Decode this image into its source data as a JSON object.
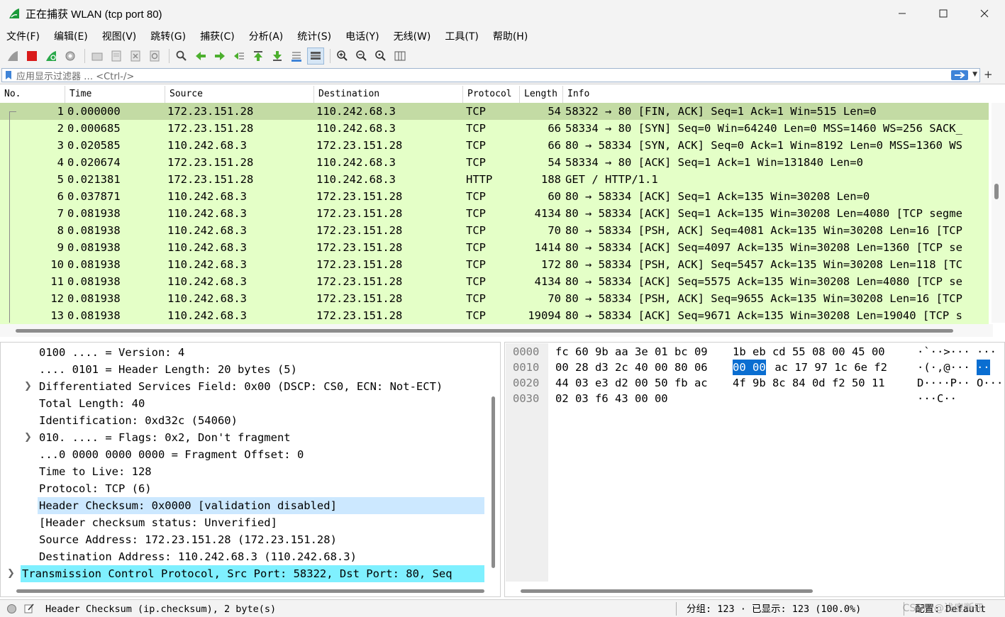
{
  "window": {
    "title": "正在捕获 WLAN (tcp port 80)",
    "icons": [
      "wireshark-fin-icon",
      "minimize-icon",
      "maximize-icon",
      "close-icon"
    ]
  },
  "menu": [
    "文件(F)",
    "编辑(E)",
    "视图(V)",
    "跳转(G)",
    "捕获(C)",
    "分析(A)",
    "统计(S)",
    "电话(Y)",
    "无线(W)",
    "工具(T)",
    "帮助(H)"
  ],
  "toolbar": {
    "icons": [
      "start-capture-icon",
      "stop-capture-icon",
      "restart-capture-icon",
      "capture-options-icon",
      "open-file-icon",
      "save-file-icon",
      "close-file-icon",
      "reload-file-icon",
      "find-packet-icon",
      "go-back-icon",
      "go-forward-icon",
      "go-to-packet-icon",
      "first-packet-icon",
      "last-packet-icon",
      "autoscroll-icon",
      "colorize-icon",
      "zoom-in-icon",
      "zoom-out-icon",
      "normal-size-icon",
      "resize-columns-icon"
    ]
  },
  "filter": {
    "placeholder": "应用显示过滤器 … <Ctrl-/>",
    "plus": "+"
  },
  "packet_list": {
    "columns": [
      "No.",
      "Time",
      "Source",
      "Destination",
      "Protocol",
      "Length",
      "Info"
    ],
    "rows": [
      {
        "no": "1",
        "time": "0.000000",
        "source": "172.23.151.28",
        "destination": "110.242.68.3",
        "protocol": "TCP",
        "length": "54",
        "info": "58322 → 80 [FIN, ACK] Seq=1 Ack=1 Win=515 Len=0"
      },
      {
        "no": "2",
        "time": "0.000685",
        "source": "172.23.151.28",
        "destination": "110.242.68.3",
        "protocol": "TCP",
        "length": "66",
        "info": "58334 → 80 [SYN] Seq=0 Win=64240 Len=0 MSS=1460 WS=256 SACK_"
      },
      {
        "no": "3",
        "time": "0.020585",
        "source": "110.242.68.3",
        "destination": "172.23.151.28",
        "protocol": "TCP",
        "length": "66",
        "info": "80 → 58334 [SYN, ACK] Seq=0 Ack=1 Win=8192 Len=0 MSS=1360 WS"
      },
      {
        "no": "4",
        "time": "0.020674",
        "source": "172.23.151.28",
        "destination": "110.242.68.3",
        "protocol": "TCP",
        "length": "54",
        "info": "58334 → 80 [ACK] Seq=1 Ack=1 Win=131840 Len=0"
      },
      {
        "no": "5",
        "time": "0.021381",
        "source": "172.23.151.28",
        "destination": "110.242.68.3",
        "protocol": "HTTP",
        "length": "188",
        "info": "GET / HTTP/1.1"
      },
      {
        "no": "6",
        "time": "0.037871",
        "source": "110.242.68.3",
        "destination": "172.23.151.28",
        "protocol": "TCP",
        "length": "60",
        "info": "80 → 58334 [ACK] Seq=1 Ack=135 Win=30208 Len=0"
      },
      {
        "no": "7",
        "time": "0.081938",
        "source": "110.242.68.3",
        "destination": "172.23.151.28",
        "protocol": "TCP",
        "length": "4134",
        "info": "80 → 58334 [ACK] Seq=1 Ack=135 Win=30208 Len=4080 [TCP segme"
      },
      {
        "no": "8",
        "time": "0.081938",
        "source": "110.242.68.3",
        "destination": "172.23.151.28",
        "protocol": "TCP",
        "length": "70",
        "info": "80 → 58334 [PSH, ACK] Seq=4081 Ack=135 Win=30208 Len=16 [TCP"
      },
      {
        "no": "9",
        "time": "0.081938",
        "source": "110.242.68.3",
        "destination": "172.23.151.28",
        "protocol": "TCP",
        "length": "1414",
        "info": "80 → 58334 [ACK] Seq=4097 Ack=135 Win=30208 Len=1360 [TCP se"
      },
      {
        "no": "10",
        "time": "0.081938",
        "source": "110.242.68.3",
        "destination": "172.23.151.28",
        "protocol": "TCP",
        "length": "172",
        "info": "80 → 58334 [PSH, ACK] Seq=5457 Ack=135 Win=30208 Len=118 [TC"
      },
      {
        "no": "11",
        "time": "0.081938",
        "source": "110.242.68.3",
        "destination": "172.23.151.28",
        "protocol": "TCP",
        "length": "4134",
        "info": "80 → 58334 [ACK] Seq=5575 Ack=135 Win=30208 Len=4080 [TCP se"
      },
      {
        "no": "12",
        "time": "0.081938",
        "source": "110.242.68.3",
        "destination": "172.23.151.28",
        "protocol": "TCP",
        "length": "70",
        "info": "80 → 58334 [PSH, ACK] Seq=9655 Ack=135 Win=30208 Len=16 [TCP"
      },
      {
        "no": "13",
        "time": "0.081938",
        "source": "110.242.68.3",
        "destination": "172.23.151.28",
        "protocol": "TCP",
        "length": "19094",
        "info": "80 → 58334 [ACK] Seq=9671 Ack=135 Win=30208 Len=19040 [TCP s"
      }
    ],
    "row_color": "#e4ffc7",
    "selected_color": "#c3dba4"
  },
  "details": {
    "lines": [
      {
        "text": "0100 .... = Version: 4",
        "expander": false
      },
      {
        "text": ".... 0101 = Header Length: 20 bytes (5)",
        "expander": false
      },
      {
        "text": "Differentiated Services Field: 0x00 (DSCP: CS0, ECN: Not-ECT)",
        "expander": true
      },
      {
        "text": "Total Length: 40",
        "expander": false
      },
      {
        "text": "Identification: 0xd32c (54060)",
        "expander": false
      },
      {
        "text": "010. .... = Flags: 0x2, Don't fragment",
        "expander": true
      },
      {
        "text": "...0 0000 0000 0000 = Fragment Offset: 0",
        "expander": false
      },
      {
        "text": "Time to Live: 128",
        "expander": false
      },
      {
        "text": "Protocol: TCP (6)",
        "expander": false
      },
      {
        "text": "Header Checksum: 0x0000 [validation disabled]",
        "expander": false,
        "highlight": true
      },
      {
        "text": "[Header checksum status: Unverified]",
        "expander": false
      },
      {
        "text": "Source Address: 172.23.151.28 (172.23.151.28)",
        "expander": false
      },
      {
        "text": "Destination Address: 110.242.68.3 (110.242.68.3)",
        "expander": false
      }
    ],
    "protocol_line": "Transmission Control Protocol, Src Port: 58322, Dst Port: 80, Seq",
    "highlight_color": "#cce8ff",
    "protocol_color": "#7ff0ff"
  },
  "bytes": {
    "rows": [
      {
        "offset": "0000",
        "hex1": "fc 60 9b aa 3e 01 bc 09",
        "hex2a": "1b eb",
        "hex2sel": "",
        "hex2b": " cd 55 08 00 45 00",
        "ascii1": "·`··>···",
        "ascii2a": " ···",
        "asciisel": ""
      },
      {
        "offset": "0010",
        "hex1": "00 28 d3 2c 40 00 80 06",
        "hex2a": "",
        "hex2sel": "00 00",
        "hex2b": " ac 17 97 1c 6e f2",
        "ascii1": "·(·,@···",
        "ascii2a": " ",
        "asciisel": "··"
      },
      {
        "offset": "0020",
        "hex1": "44 03 e3 d2 00 50 fb ac",
        "hex2a": "4f 9b",
        "hex2sel": "",
        "hex2b": " 8c 84 0d f2 50 11",
        "ascii1": "D····P··",
        "ascii2a": " O···",
        "asciisel": ""
      },
      {
        "offset": "0030",
        "hex1": "02 03 f6 43 00 00",
        "hex2a": "",
        "hex2sel": "",
        "hex2b": "",
        "ascii1": "···C··",
        "ascii2a": "",
        "asciisel": ""
      }
    ],
    "selection_color": "#0a6ed1"
  },
  "status": {
    "field": "Header Checksum (ip.checksum), 2 byte(s)",
    "packets": "分组: 123 · 已显示: 123 (100.0%)",
    "profile": "配置: Default",
    "watermark": "CSDN @浅度断冊"
  }
}
